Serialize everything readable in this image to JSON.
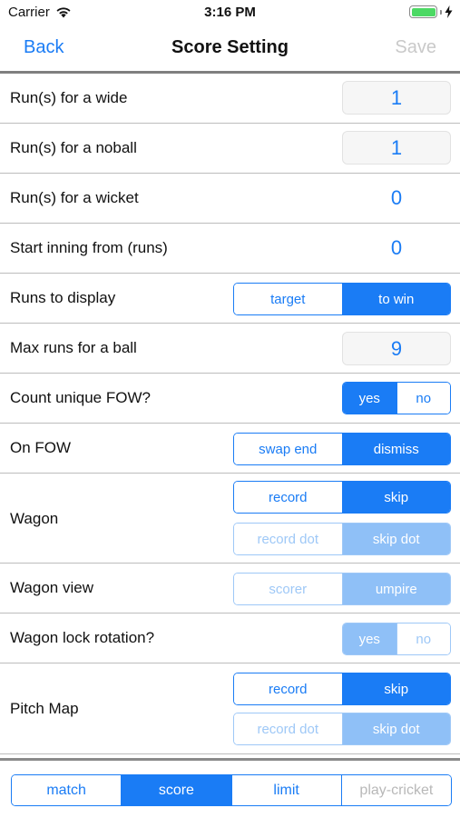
{
  "status_bar": {
    "carrier": "Carrier",
    "time": "3:16 PM",
    "icons": [
      "wifi-icon",
      "battery-icon",
      "charging-bolt-icon"
    ]
  },
  "nav": {
    "back_label": "Back",
    "title": "Score Setting",
    "save_label": "Save"
  },
  "settings": {
    "wide": {
      "label": "Run(s) for a wide",
      "value": "1"
    },
    "noball": {
      "label": "Run(s) for a noball",
      "value": "1"
    },
    "wicket": {
      "label": "Run(s) for a wicket",
      "value": "0"
    },
    "start_inning": {
      "label": "Start inning from (runs)",
      "value": "0"
    },
    "runs_display": {
      "label": "Runs to display",
      "options": [
        "target",
        "to win"
      ],
      "selected": "to win"
    },
    "max_runs": {
      "label": "Max runs for a ball",
      "value": "9"
    },
    "unique_fow": {
      "label": "Count unique FOW?",
      "options": [
        "yes",
        "no"
      ],
      "selected": "yes"
    },
    "on_fow": {
      "label": "On FOW",
      "options": [
        "swap end",
        "dismiss"
      ],
      "selected": "dismiss"
    },
    "wagon": {
      "label": "Wagon",
      "options": [
        "record",
        "skip"
      ],
      "selected": "skip",
      "dot_options": [
        "record dot",
        "skip dot"
      ],
      "dot_selected": "skip dot"
    },
    "wagon_view": {
      "label": "Wagon view",
      "options": [
        "scorer",
        "umpire"
      ],
      "selected": "umpire"
    },
    "wagon_lock": {
      "label": "Wagon lock rotation?",
      "options": [
        "yes",
        "no"
      ],
      "selected": "yes"
    },
    "pitch_map": {
      "label": "Pitch Map",
      "options": [
        "record",
        "skip"
      ],
      "selected": "skip",
      "dot_options": [
        "record dot",
        "skip dot"
      ],
      "dot_selected": "skip dot"
    }
  },
  "bottom_tabs": {
    "items": [
      "match",
      "score",
      "limit",
      "play-cricket"
    ],
    "selected": "score"
  },
  "colors": {
    "accent": "#1a7cf5",
    "accent_disabled": "#8fc0f7",
    "disabled_text": "#c9c9c9",
    "battery": "#4cd964"
  }
}
